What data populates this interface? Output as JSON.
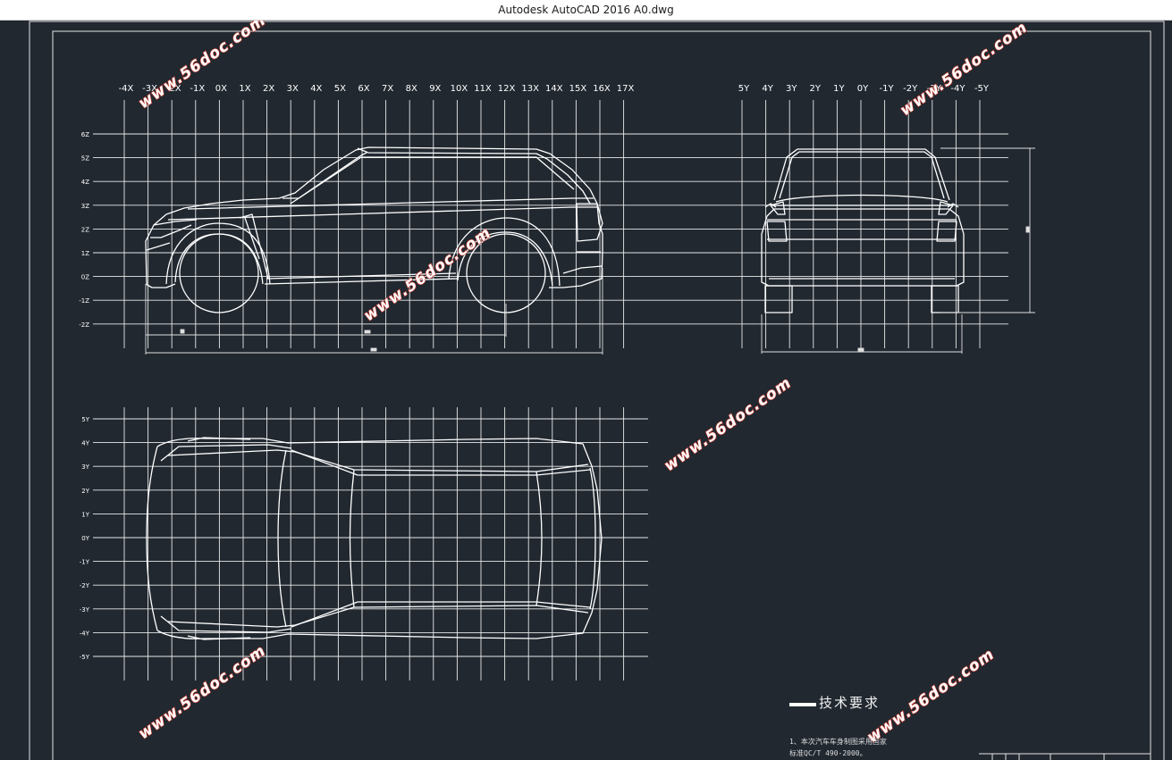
{
  "window": {
    "title": "Autodesk AutoCAD 2016     A0.dwg"
  },
  "side_view": {
    "x_ticks": [
      "-4X",
      "-3X",
      "-2X",
      "-1X",
      "0X",
      "1X",
      "2X",
      "3X",
      "4X",
      "5X",
      "6X",
      "7X",
      "8X",
      "9X",
      "10X",
      "11X",
      "12X",
      "13X",
      "14X",
      "15X",
      "16X",
      "17X"
    ],
    "z_ticks": [
      "6Z",
      "5Z",
      "4Z",
      "3Z",
      "2Z",
      "1Z",
      "0Z",
      "-1Z",
      "-2Z"
    ]
  },
  "front_view": {
    "y_ticks": [
      "5Y",
      "4Y",
      "3Y",
      "2Y",
      "1Y",
      "0Y",
      "-1Y",
      "-2Y",
      "-3Y",
      "-4Y",
      "-5Y"
    ]
  },
  "top_view": {
    "y_ticks": [
      "5Y",
      "4Y",
      "3Y",
      "2Y",
      "1Y",
      "0Y",
      "-1Y",
      "-2Y",
      "-3Y",
      "-4Y",
      "-5Y"
    ]
  },
  "technical_requirements": {
    "title": "技术要求",
    "line1": "1、本次汽车车身制图采用国家",
    "line2": "标准QC/T 490-2000。"
  },
  "watermark": "www.56doc.com",
  "colors": {
    "background": "#212830",
    "lines": "#ffffff",
    "watermark_stroke": "#c43a2e"
  }
}
